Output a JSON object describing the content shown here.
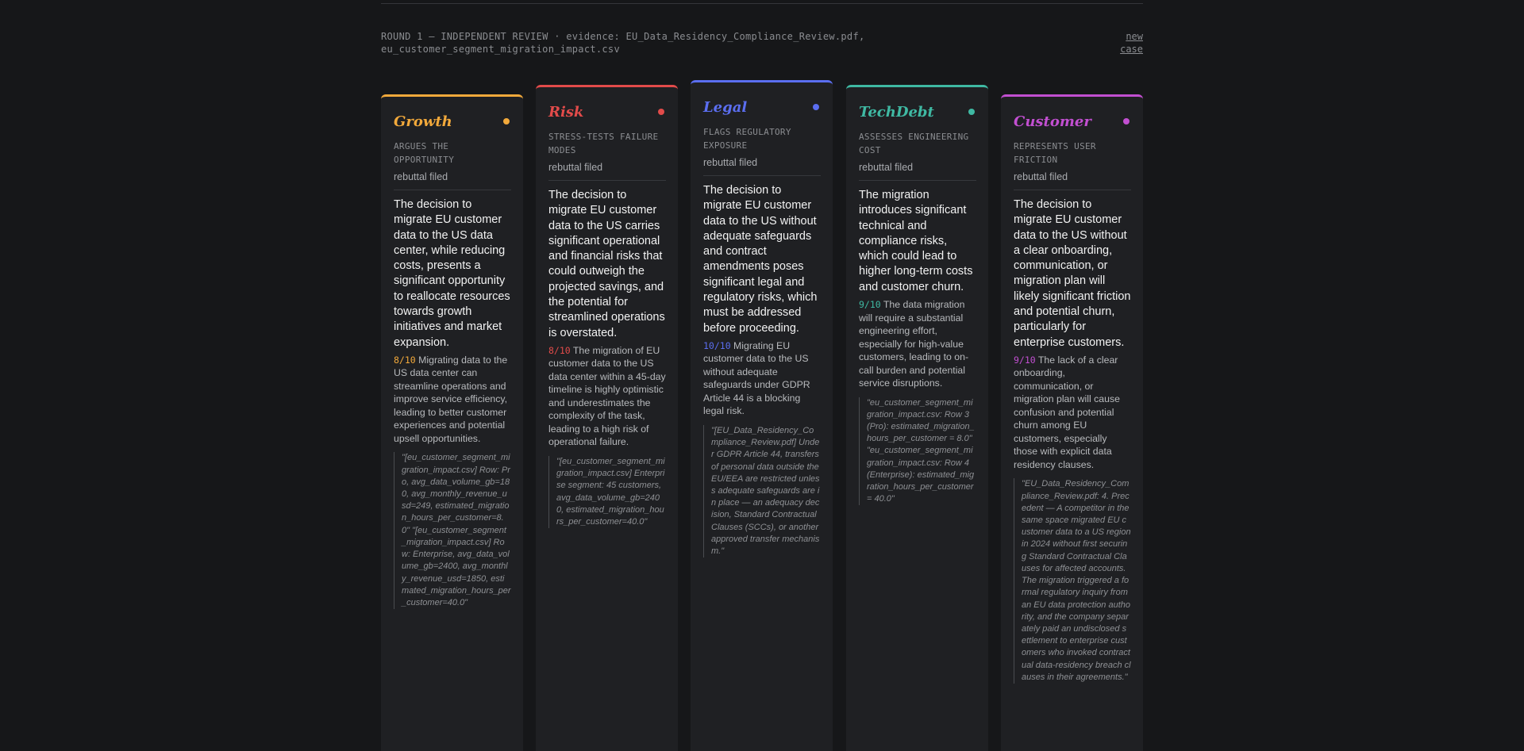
{
  "header": {
    "round_text": "ROUND 1 — INDEPENDENT REVIEW · evidence: EU_Data_Residency_Compliance_Review.pdf, eu_customer_segment_migration_impact.csv",
    "new_case_label": "new case"
  },
  "columns": [
    {
      "title": "Growth",
      "accent": "#f2a93b",
      "role": "ARGUES THE OPPORTUNITY",
      "status": "rebuttal filed",
      "claim": "The decision to migrate EU customer data to the US data center, while reducing costs, presents a significant opportunity to reallocate resources towards growth initiatives and market expansion.",
      "score": "8/10",
      "argument": "Migrating data to the US data center can streamline operations and improve service efficiency, leading to better customer experiences and potential upsell opportunities.",
      "evidence": "\"[eu_customer_segment_migration_impact.csv] Row: Pro, avg_data_volume_gb=180, avg_monthly_revenue_usd=249, estimated_migration_hours_per_customer=8.0\" \"[eu_customer_segment_migration_impact.csv] Row: Enterprise, avg_data_volume_gb=2400, avg_monthly_revenue_usd=1850, estimated_migration_hours_per_customer=40.0\""
    },
    {
      "title": "Risk",
      "accent": "#e24b4a",
      "role": "STRESS-TESTS FAILURE MODES",
      "status": "rebuttal filed",
      "claim": "The decision to migrate EU customer data to the US carries significant operational and financial risks that could outweigh the projected savings, and the potential for streamlined operations is overstated.",
      "score": "8/10",
      "argument": "The migration of EU customer data to the US data center within a 45-day timeline is highly optimistic and underestimates the complexity of the task, leading to a high risk of operational failure.",
      "evidence": "\"[eu_customer_segment_migration_impact.csv] Enterprise segment: 45 customers, avg_data_volume_gb=2400, estimated_migration_hours_per_customer=40.0\""
    },
    {
      "title": "Legal",
      "accent": "#5b6ef0",
      "role": "FLAGS REGULATORY EXPOSURE",
      "status": "rebuttal filed",
      "claim": "The decision to migrate EU customer data to the US without adequate safeguards and contract amendments poses significant legal and regulatory risks, which must be addressed before proceeding.",
      "score": "10/10",
      "argument": "Migrating EU customer data to the US without adequate safeguards under GDPR Article 44 is a blocking legal risk.",
      "evidence": "\"[EU_Data_Residency_Compliance_Review.pdf] Under GDPR Article 44, transfers of personal data outside the EU/EEA are restricted unless adequate safeguards are in place — an adequacy decision, Standard Contractual Clauses (SCCs), or another approved transfer mechanism.\""
    },
    {
      "title": "TechDebt",
      "accent": "#3fb9a3",
      "role": "ASSESSES ENGINEERING COST",
      "status": "rebuttal filed",
      "claim": "The migration introduces significant technical and compliance risks, which could lead to higher long-term costs and customer churn.",
      "score": "9/10",
      "argument": "The data migration will require a substantial engineering effort, especially for high-value customers, leading to on-call burden and potential service disruptions.",
      "evidence": "\"eu_customer_segment_migration_impact.csv: Row 3 (Pro): estimated_migration_hours_per_customer = 8.0\" \"eu_customer_segment_migration_impact.csv: Row 4 (Enterprise): estimated_migration_hours_per_customer = 40.0\""
    },
    {
      "title": "Customer",
      "accent": "#c24fd1",
      "role": "REPRESENTS USER FRICTION",
      "status": "rebuttal filed",
      "claim": "The decision to migrate EU customer data to the US without a clear onboarding, communication, or migration plan will likely significant friction and potential churn, particularly for enterprise customers.",
      "score": "9/10",
      "argument": "The lack of a clear onboarding, communication, or migration plan will cause confusion and potential churn among EU customers, especially those with explicit data residency clauses.",
      "evidence": "\"EU_Data_Residency_Compliance_Review.pdf: 4. Precedent — A competitor in the same space migrated EU customer data to a US region in 2024 without first securing Standard Contractual Clauses for affected accounts. The migration triggered a formal regulatory inquiry from an EU data protection authority, and the company separately paid an undisclosed settlement to enterprise customers who invoked contractual data-residency breach clauses in their agreements.\""
    }
  ]
}
